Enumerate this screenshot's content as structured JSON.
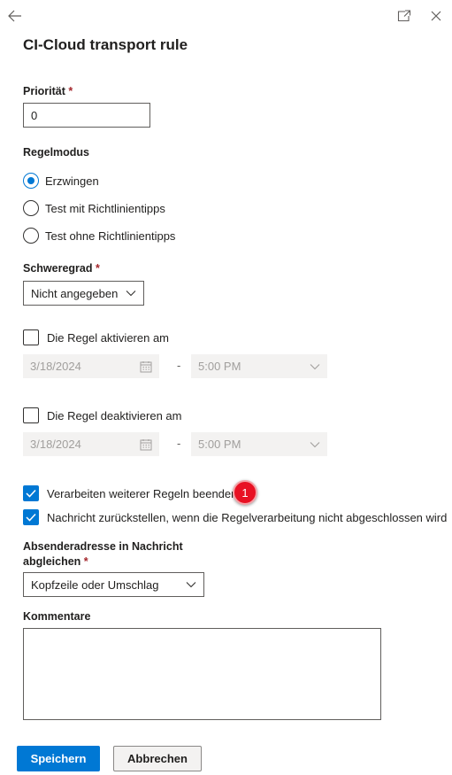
{
  "header": {
    "title": "CI-Cloud transport rule"
  },
  "priority": {
    "label": "Priorität",
    "required_mark": "*",
    "value": "0"
  },
  "rule_mode": {
    "label": "Regelmodus",
    "options": [
      {
        "label": "Erzwingen",
        "checked": true
      },
      {
        "label": "Test mit Richtlinientipps",
        "checked": false
      },
      {
        "label": "Test ohne Richtlinientipps",
        "checked": false
      }
    ]
  },
  "severity": {
    "label": "Schweregrad",
    "required_mark": "*",
    "value": "Nicht angegeben"
  },
  "activate": {
    "label": "Die Regel aktivieren am",
    "checked": false,
    "date": "3/18/2024",
    "separator": "-",
    "time": "5:00 PM"
  },
  "deactivate": {
    "label": "Die Regel deaktivieren am",
    "checked": false,
    "date": "3/18/2024",
    "separator": "-",
    "time": "5:00 PM"
  },
  "stop_processing": {
    "label": "Verarbeiten weiterer Regeln beenden",
    "checked": true,
    "badge": "1"
  },
  "defer_message": {
    "label": "Nachricht zurückstellen, wenn die Regelverarbeitung nicht abgeschlossen wird",
    "checked": true
  },
  "sender_match": {
    "label_line1": "Absenderadresse in Nachricht",
    "label_line2": "abgleichen",
    "required_mark": "*",
    "value": "Kopfzeile oder Umschlag"
  },
  "comments": {
    "label": "Kommentare",
    "value": ""
  },
  "footer": {
    "save_label": "Speichern",
    "cancel_label": "Abbrechen"
  },
  "colors": {
    "accent": "#0078d4",
    "required": "#a4262c",
    "badge": "#e81123"
  }
}
